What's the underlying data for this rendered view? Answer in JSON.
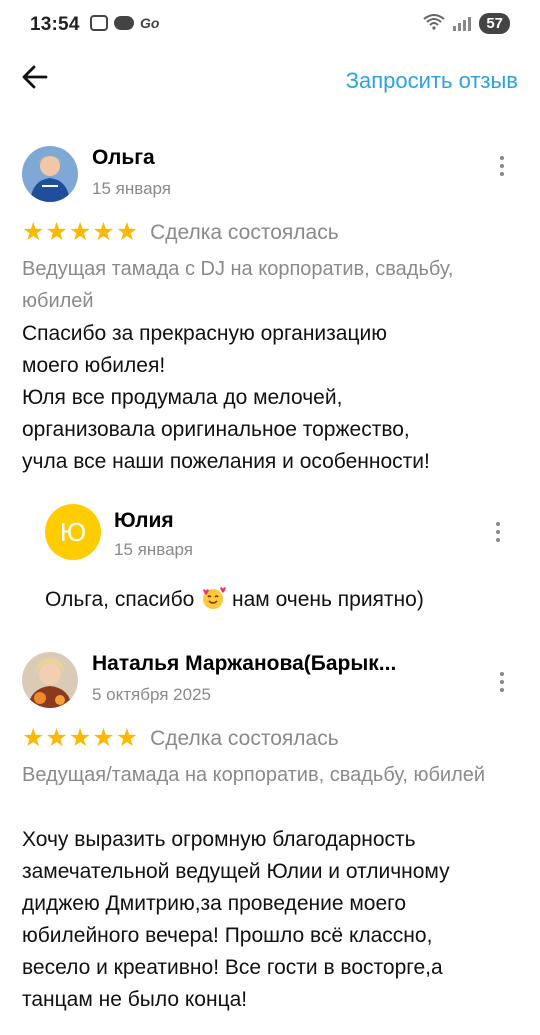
{
  "status_bar": {
    "time": "13:54",
    "battery": "57"
  },
  "header": {
    "request_review_label": "Запросить отзыв"
  },
  "reviews": [
    {
      "name": "Ольга",
      "date": "15 января",
      "rating": 5,
      "deal_status": "Сделка состоялась",
      "service": "Ведущая тамада с DJ на корпоратив, свадьбу, юбилей",
      "text": "Спасибо за прекрасную организацию\nмоего юбилея!\nЮля все  продумала до мелочей,\nорганизовала оригинальное торжество,\nучла  все наши пожелания и особенности!",
      "reply": {
        "avatar_letter": "Ю",
        "name": "Юлия",
        "date": "15 января",
        "text_before_emoji": "Ольга, спасибо",
        "text_after_emoji": " нам очень приятно)"
      }
    },
    {
      "name": "Наталья Маржанова(Барык...",
      "date": "5 октября 2025",
      "rating": 5,
      "deal_status": "Сделка состоялась",
      "service": "Ведущая/тамада на корпоратив, свадьбу, юбилей",
      "text": "Хочу выразить огромную благодарность\nзамечательной ведущей Юлии и отличному\nдиджею Дмитрию,за проведение моего\nюбилейного вечера! Прошло всё классно,\nвесело и креативно! Все гости в восторге,а\nтанцам не было конца!"
    }
  ],
  "colors": {
    "accent": "#2aa3e5",
    "star": "#ffb800",
    "reply_avatar": "#ffcc00",
    "muted_text": "#8a8a8a"
  },
  "icons": {
    "back": "arrow-left-icon",
    "more": "more-vertical-icon",
    "star": "star-icon",
    "emoji": "smiling-face-with-hearts-icon"
  }
}
